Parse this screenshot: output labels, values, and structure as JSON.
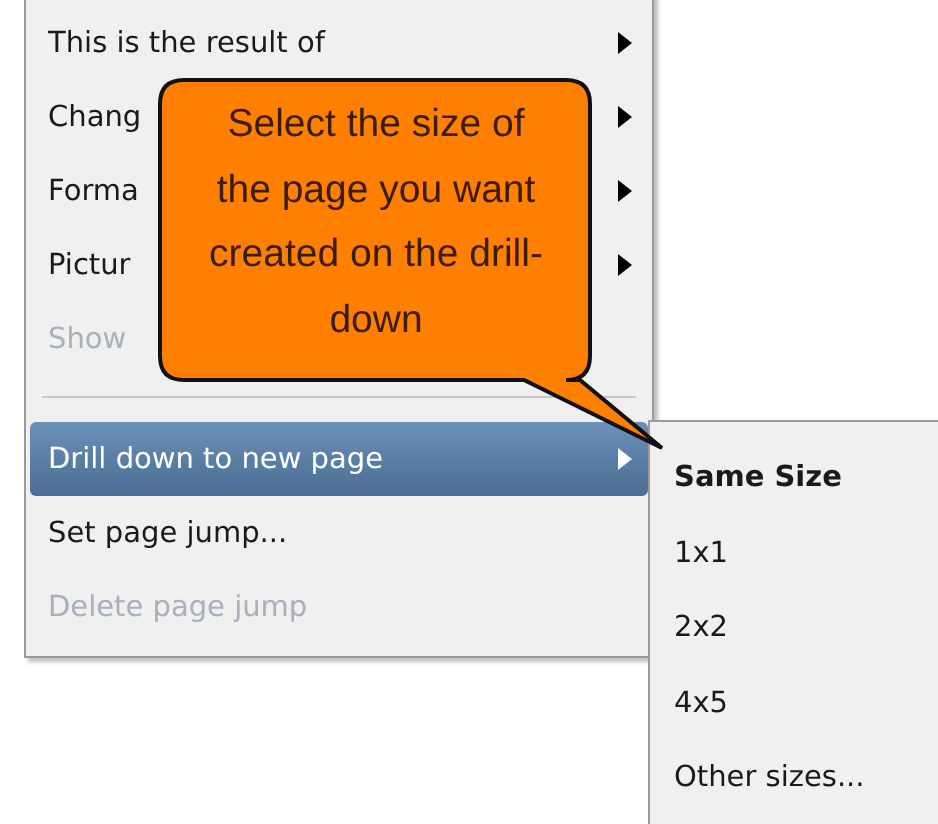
{
  "menu": {
    "items": [
      {
        "kind": "item",
        "label": "This is the result of",
        "has_submenu": true,
        "disabled": false,
        "selected": false
      },
      {
        "kind": "item",
        "label": "Chang",
        "has_submenu": true,
        "disabled": false,
        "selected": false
      },
      {
        "kind": "item",
        "label": "Forma",
        "has_submenu": true,
        "disabled": false,
        "selected": false
      },
      {
        "kind": "item",
        "label": "Pictur",
        "has_submenu": true,
        "disabled": false,
        "selected": false
      },
      {
        "kind": "item",
        "label": "Show",
        "has_submenu": false,
        "disabled": true,
        "selected": false
      },
      {
        "kind": "separator"
      },
      {
        "kind": "item",
        "label": "Drill down to new page",
        "has_submenu": true,
        "disabled": false,
        "selected": true
      },
      {
        "kind": "item",
        "label": "Set page jump...",
        "has_submenu": false,
        "disabled": false,
        "selected": false
      },
      {
        "kind": "item",
        "label": "Delete page jump",
        "has_submenu": false,
        "disabled": true,
        "selected": false
      }
    ]
  },
  "submenu": {
    "items": [
      {
        "label": "Same Size",
        "bold": true
      },
      {
        "label": "1x1",
        "bold": false
      },
      {
        "label": "2x2",
        "bold": false
      },
      {
        "label": "4x5",
        "bold": false
      },
      {
        "label": "Other sizes...",
        "bold": false
      }
    ]
  },
  "callout": {
    "text": "Select the size of the page you want created on the drill-down"
  }
}
